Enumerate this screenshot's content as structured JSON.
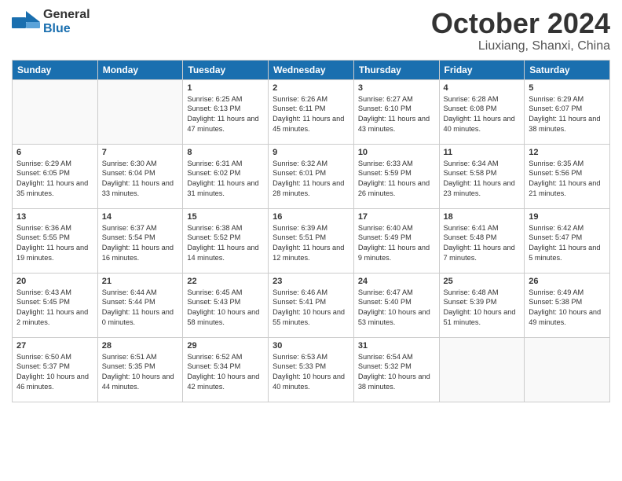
{
  "header": {
    "logo": {
      "general": "General",
      "blue": "Blue"
    },
    "title": "October 2024",
    "location": "Liuxiang, Shanxi, China"
  },
  "weekdays": [
    "Sunday",
    "Monday",
    "Tuesday",
    "Wednesday",
    "Thursday",
    "Friday",
    "Saturday"
  ],
  "weeks": [
    [
      {
        "day": "",
        "empty": true
      },
      {
        "day": "",
        "empty": true
      },
      {
        "day": "1",
        "sunrise": "6:25 AM",
        "sunset": "6:13 PM",
        "daylight": "11 hours and 47 minutes."
      },
      {
        "day": "2",
        "sunrise": "6:26 AM",
        "sunset": "6:11 PM",
        "daylight": "11 hours and 45 minutes."
      },
      {
        "day": "3",
        "sunrise": "6:27 AM",
        "sunset": "6:10 PM",
        "daylight": "11 hours and 43 minutes."
      },
      {
        "day": "4",
        "sunrise": "6:28 AM",
        "sunset": "6:08 PM",
        "daylight": "11 hours and 40 minutes."
      },
      {
        "day": "5",
        "sunrise": "6:29 AM",
        "sunset": "6:07 PM",
        "daylight": "11 hours and 38 minutes."
      }
    ],
    [
      {
        "day": "6",
        "sunrise": "6:29 AM",
        "sunset": "6:05 PM",
        "daylight": "11 hours and 35 minutes."
      },
      {
        "day": "7",
        "sunrise": "6:30 AM",
        "sunset": "6:04 PM",
        "daylight": "11 hours and 33 minutes."
      },
      {
        "day": "8",
        "sunrise": "6:31 AM",
        "sunset": "6:02 PM",
        "daylight": "11 hours and 31 minutes."
      },
      {
        "day": "9",
        "sunrise": "6:32 AM",
        "sunset": "6:01 PM",
        "daylight": "11 hours and 28 minutes."
      },
      {
        "day": "10",
        "sunrise": "6:33 AM",
        "sunset": "5:59 PM",
        "daylight": "11 hours and 26 minutes."
      },
      {
        "day": "11",
        "sunrise": "6:34 AM",
        "sunset": "5:58 PM",
        "daylight": "11 hours and 23 minutes."
      },
      {
        "day": "12",
        "sunrise": "6:35 AM",
        "sunset": "5:56 PM",
        "daylight": "11 hours and 21 minutes."
      }
    ],
    [
      {
        "day": "13",
        "sunrise": "6:36 AM",
        "sunset": "5:55 PM",
        "daylight": "11 hours and 19 minutes."
      },
      {
        "day": "14",
        "sunrise": "6:37 AM",
        "sunset": "5:54 PM",
        "daylight": "11 hours and 16 minutes."
      },
      {
        "day": "15",
        "sunrise": "6:38 AM",
        "sunset": "5:52 PM",
        "daylight": "11 hours and 14 minutes."
      },
      {
        "day": "16",
        "sunrise": "6:39 AM",
        "sunset": "5:51 PM",
        "daylight": "11 hours and 12 minutes."
      },
      {
        "day": "17",
        "sunrise": "6:40 AM",
        "sunset": "5:49 PM",
        "daylight": "11 hours and 9 minutes."
      },
      {
        "day": "18",
        "sunrise": "6:41 AM",
        "sunset": "5:48 PM",
        "daylight": "11 hours and 7 minutes."
      },
      {
        "day": "19",
        "sunrise": "6:42 AM",
        "sunset": "5:47 PM",
        "daylight": "11 hours and 5 minutes."
      }
    ],
    [
      {
        "day": "20",
        "sunrise": "6:43 AM",
        "sunset": "5:45 PM",
        "daylight": "11 hours and 2 minutes."
      },
      {
        "day": "21",
        "sunrise": "6:44 AM",
        "sunset": "5:44 PM",
        "daylight": "11 hours and 0 minutes."
      },
      {
        "day": "22",
        "sunrise": "6:45 AM",
        "sunset": "5:43 PM",
        "daylight": "10 hours and 58 minutes."
      },
      {
        "day": "23",
        "sunrise": "6:46 AM",
        "sunset": "5:41 PM",
        "daylight": "10 hours and 55 minutes."
      },
      {
        "day": "24",
        "sunrise": "6:47 AM",
        "sunset": "5:40 PM",
        "daylight": "10 hours and 53 minutes."
      },
      {
        "day": "25",
        "sunrise": "6:48 AM",
        "sunset": "5:39 PM",
        "daylight": "10 hours and 51 minutes."
      },
      {
        "day": "26",
        "sunrise": "6:49 AM",
        "sunset": "5:38 PM",
        "daylight": "10 hours and 49 minutes."
      }
    ],
    [
      {
        "day": "27",
        "sunrise": "6:50 AM",
        "sunset": "5:37 PM",
        "daylight": "10 hours and 46 minutes."
      },
      {
        "day": "28",
        "sunrise": "6:51 AM",
        "sunset": "5:35 PM",
        "daylight": "10 hours and 44 minutes."
      },
      {
        "day": "29",
        "sunrise": "6:52 AM",
        "sunset": "5:34 PM",
        "daylight": "10 hours and 42 minutes."
      },
      {
        "day": "30",
        "sunrise": "6:53 AM",
        "sunset": "5:33 PM",
        "daylight": "10 hours and 40 minutes."
      },
      {
        "day": "31",
        "sunrise": "6:54 AM",
        "sunset": "5:32 PM",
        "daylight": "10 hours and 38 minutes."
      },
      {
        "day": "",
        "empty": true
      },
      {
        "day": "",
        "empty": true
      }
    ]
  ]
}
